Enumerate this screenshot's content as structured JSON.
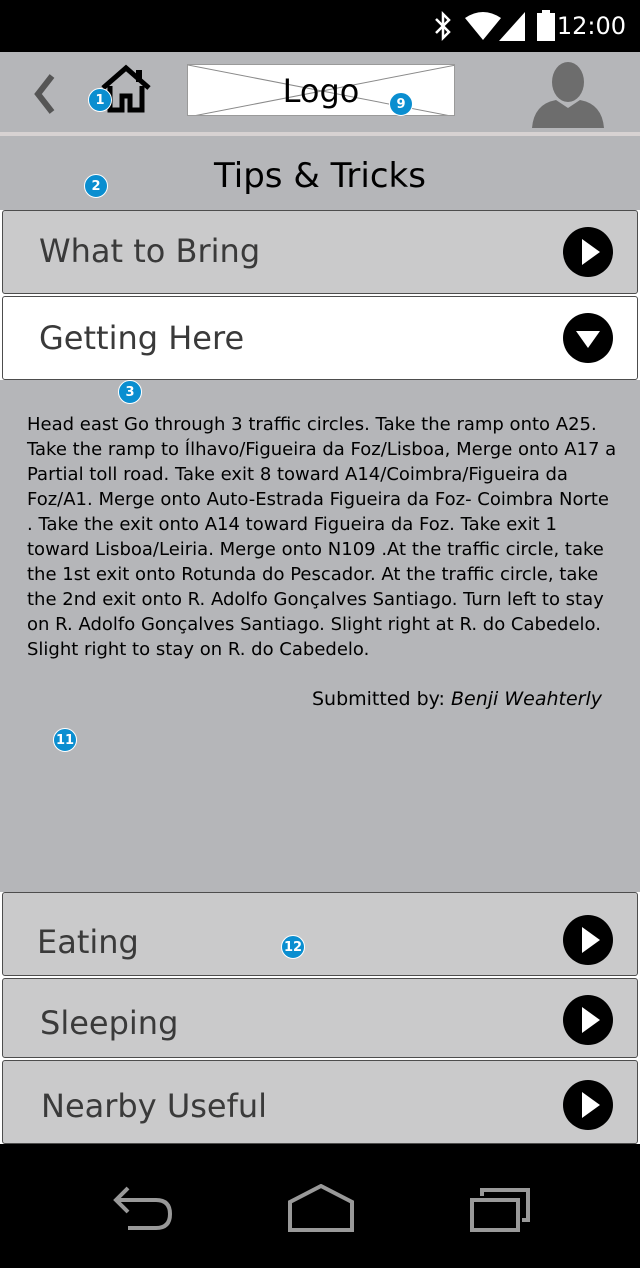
{
  "status_bar": {
    "time": "12:00",
    "icons": [
      "bluetooth-icon",
      "wifi-icon",
      "signal-icon",
      "battery-icon"
    ]
  },
  "app_bar": {
    "logo_text": "Logo",
    "icons": [
      "back-arrow-icon",
      "home-icon",
      "user-avatar-icon"
    ]
  },
  "annotations": {
    "home": "1",
    "title": "2",
    "getting_here": "3",
    "logo": "9",
    "panel": "11",
    "eating": "12"
  },
  "page_title": "Tips & Tricks",
  "sections": [
    {
      "label": "What to Bring",
      "state": "collapsed"
    },
    {
      "label": "Getting Here",
      "state": "expanded"
    },
    {
      "label": "Eating",
      "state": "collapsed"
    },
    {
      "label": "Sleeping",
      "state": "collapsed"
    },
    {
      "label": "Nearby Useful",
      "state": "collapsed"
    }
  ],
  "getting_here": {
    "directions": "Head east Go through 3 traffic circles. Take the ramp onto A25. Take the ramp to Ílhavo/Figueira da Foz/Lisboa, Merge onto A17 a Partial toll road. Take exit 8 toward A14/Coimbra/Figueira da Foz/A1. Merge onto Auto-Estrada Figueira da Foz- Coimbra Norte . Take the exit onto A14 toward Figueira da Foz. Take exit 1 toward Lisboa/Leiria. Merge onto N109 .At the traffic circle, take the 1st exit onto Rotunda do Pescador. At the traffic circle, take the 2nd exit onto R. Adolfo Gonçalves Santiago. Turn left to stay on R. Adolfo Gonçalves Santiago. Slight right at R. do Cabedelo. Slight right to stay on R. do Cabedelo.",
    "submitted_label": "Submitted by:",
    "submitted_name": "Benji Weahterly"
  },
  "nav_bar": {
    "icons": [
      "nav-back-icon",
      "nav-home-icon",
      "nav-recents-icon"
    ]
  },
  "colors": {
    "accent_badge": "#0a8ed0",
    "bar_gray": "#b5b6b9",
    "row_gray": "#cacacb"
  }
}
